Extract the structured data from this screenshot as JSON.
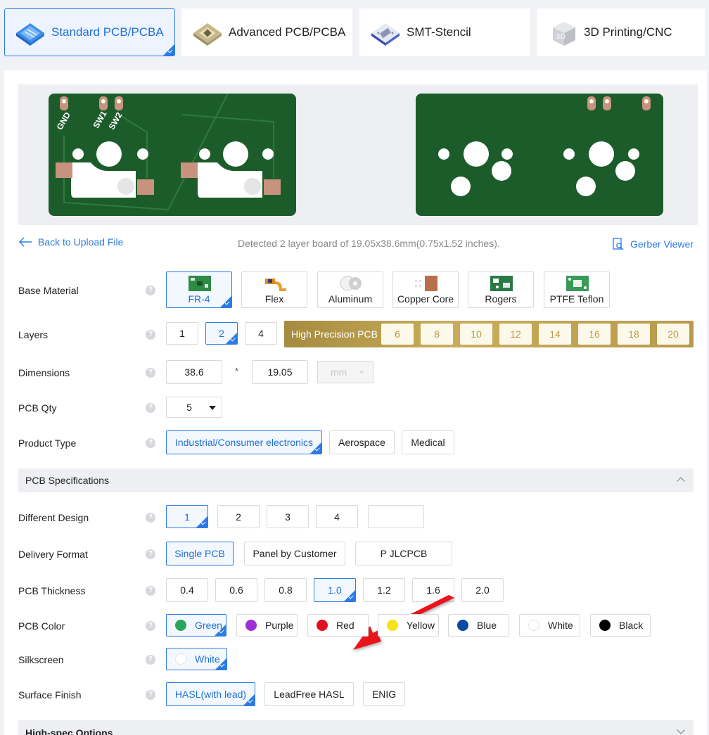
{
  "tabs": [
    {
      "label": "Standard PCB/PCBA",
      "icon": "pcb-board-icon",
      "active": true
    },
    {
      "label": "Advanced PCB/PCBA",
      "icon": "advanced-chip-icon"
    },
    {
      "label": "SMT-Stencil",
      "icon": "stencil-icon"
    },
    {
      "label": "3D Printing/CNC",
      "icon": "cube-3d-icon"
    }
  ],
  "preview": {
    "front_labels": [
      "GND",
      "SW1",
      "SW2"
    ],
    "pcb_color": "#1c5c2a"
  },
  "toolbar": {
    "back_label": "Back to Upload File",
    "detected_text": "Detected 2 layer board of 19.05x38.6mm(0.75x1.52 inches).",
    "gerber_label": "Gerber Viewer"
  },
  "form": {
    "base_material": {
      "label": "Base Material",
      "options": [
        "FR-4",
        "Flex",
        "Aluminum",
        "Copper Core",
        "Rogers",
        "PTFE Teflon"
      ],
      "selected": "FR-4"
    },
    "layers": {
      "label": "Layers",
      "options": [
        "1",
        "2",
        "4"
      ],
      "selected": "2",
      "high_precision_label": "High Precision PCB",
      "high_precision_options": [
        "6",
        "8",
        "10",
        "12",
        "14",
        "16",
        "18",
        "20"
      ]
    },
    "dimensions": {
      "label": "Dimensions",
      "width": "38.6",
      "separator": "*",
      "height": "19.05",
      "unit": "mm"
    },
    "pcb_qty": {
      "label": "PCB Qty",
      "value": "5"
    },
    "product_type": {
      "label": "Product Type",
      "options": [
        "Industrial/Consumer electronics",
        "Aerospace",
        "Medical"
      ],
      "selected": "Industrial/Consumer electronics"
    }
  },
  "specs": {
    "section_title": "PCB Specifications",
    "different_design": {
      "label": "Different Design",
      "options": [
        "1",
        "2",
        "3",
        "4",
        ""
      ],
      "selected": "1"
    },
    "delivery_format": {
      "label": "Delivery Format",
      "options": [
        "Single PCB",
        "Panel by Customer",
        "Panel by JLCPCB"
      ],
      "visible_third": "P   JLCPCB",
      "selected": "Single PCB"
    },
    "thickness": {
      "label": "PCB Thickness",
      "options": [
        "0.4",
        "0.6",
        "0.8",
        "1.0",
        "1.2",
        "1.6",
        "2.0"
      ],
      "selected": "1.0"
    },
    "color": {
      "label": "PCB Color",
      "options": [
        {
          "name": "Green",
          "hex": "#2aa65c"
        },
        {
          "name": "Purple",
          "hex": "#9b30d9"
        },
        {
          "name": "Red",
          "hex": "#e01020"
        },
        {
          "name": "Yellow",
          "hex": "#f7e31a"
        },
        {
          "name": "Blue",
          "hex": "#0a4aa0"
        },
        {
          "name": "White",
          "hex": "#ffffff"
        },
        {
          "name": "Black",
          "hex": "#000000"
        }
      ],
      "selected": "Green"
    },
    "silkscreen": {
      "label": "Silkscreen",
      "value": "White"
    },
    "surface_finish": {
      "label": "Surface Finish",
      "options": [
        "HASL(with lead)",
        "LeadFree HASL",
        "ENIG"
      ],
      "selected": "HASL(with lead)"
    }
  },
  "high_spec": {
    "section_title": "High-spec Options"
  },
  "help_glyph": "?"
}
